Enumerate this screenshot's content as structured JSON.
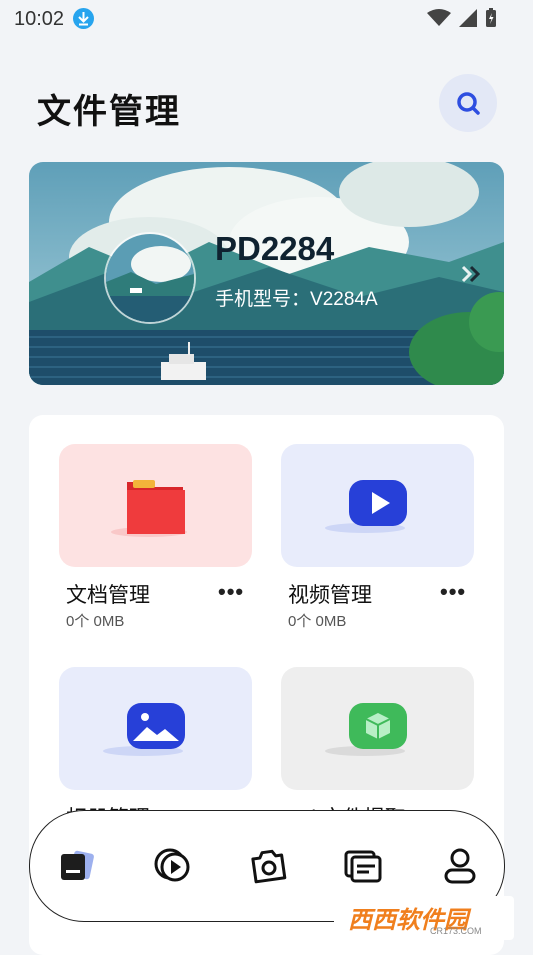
{
  "status_bar": {
    "time": "10:02"
  },
  "header": {
    "title": "文件管理"
  },
  "device": {
    "name": "PD2284",
    "model_label": "手机型号：",
    "model_value": "V2284A"
  },
  "categories": [
    {
      "label": "文档管理",
      "count": "0个",
      "size": "0MB",
      "icon": "folder-icon"
    },
    {
      "label": "视频管理",
      "count": "0个",
      "size": "0MB",
      "icon": "video-icon"
    },
    {
      "label": "相册管理",
      "icon": "photo-icon"
    },
    {
      "label": "apk文件提取",
      "icon": "cube-icon"
    }
  ],
  "more_glyph": "•••",
  "bottom_nav": [
    "files-tab",
    "media-tab",
    "camera-tab",
    "messages-tab",
    "profile-tab"
  ],
  "watermark": {
    "main": "西西软件园",
    "sub": "CR173.COM"
  },
  "colors": {
    "accent": "#2e4ee0",
    "tile_red": "#fde2e2",
    "tile_blue": "#e8ecfb",
    "tile_grey": "#eeeeee"
  }
}
